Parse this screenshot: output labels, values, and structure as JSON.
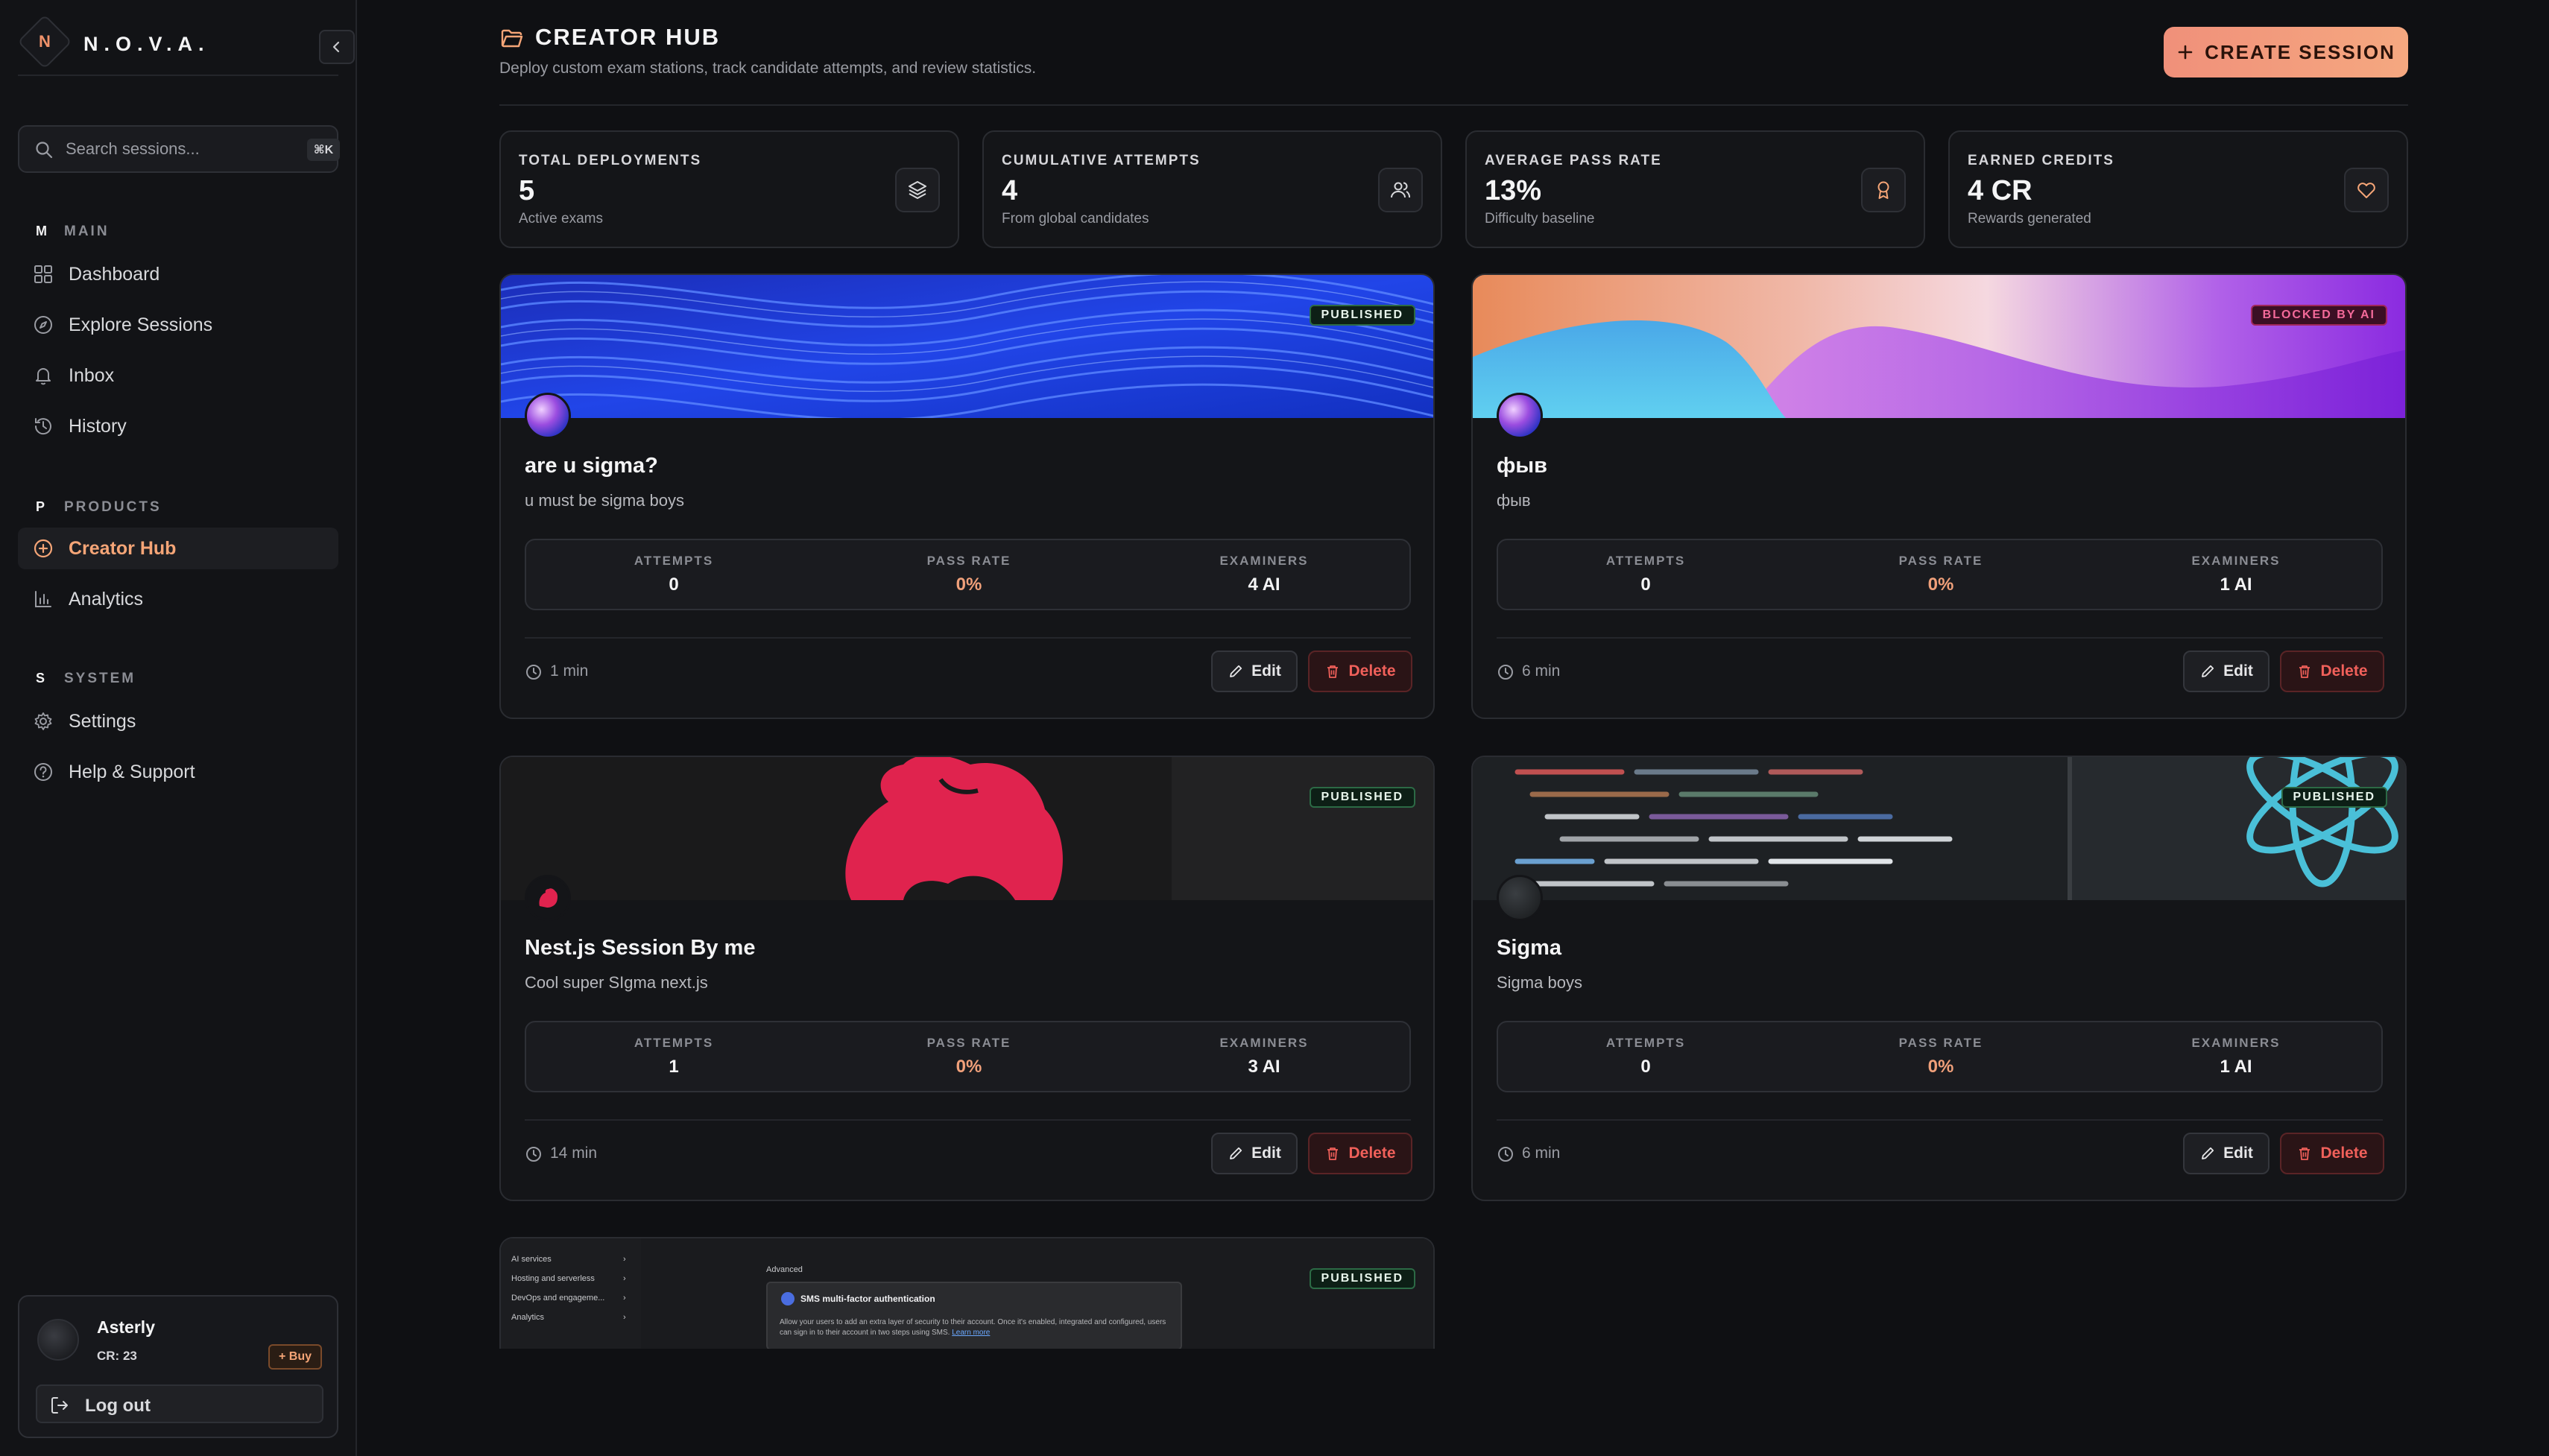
{
  "brand": {
    "name": "N.O.V.A.",
    "logo_letter": "N"
  },
  "search": {
    "placeholder": "Search sessions...",
    "shortcut": "⌘K"
  },
  "nav": {
    "main": {
      "letter": "M",
      "label": "MAIN",
      "items": [
        {
          "label": "Dashboard",
          "icon": "grid-icon"
        },
        {
          "label": "Explore Sessions",
          "icon": "compass-icon"
        },
        {
          "label": "Inbox",
          "icon": "bell-icon"
        },
        {
          "label": "History",
          "icon": "history-icon"
        }
      ]
    },
    "products": {
      "letter": "P",
      "label": "PRODUCTS",
      "items": [
        {
          "label": "Creator Hub",
          "icon": "plus-circle-icon",
          "active": true
        },
        {
          "label": "Analytics",
          "icon": "bar-chart-icon"
        }
      ]
    },
    "system": {
      "letter": "S",
      "label": "SYSTEM",
      "items": [
        {
          "label": "Settings",
          "icon": "gear-icon"
        },
        {
          "label": "Help & Support",
          "icon": "help-icon"
        }
      ]
    }
  },
  "user": {
    "name": "Asterly",
    "credits": "CR: 23",
    "buy_label": "+ Buy",
    "logout_label": "Log out"
  },
  "header": {
    "title": "CREATOR HUB",
    "subtitle": "Deploy custom exam stations, track candidate attempts, and review statistics.",
    "create_label": "CREATE SESSION"
  },
  "stats": [
    {
      "label": "TOTAL DEPLOYMENTS",
      "value": "5",
      "sub": "Active exams",
      "icon": "layers-icon"
    },
    {
      "label": "CUMULATIVE ATTEMPTS",
      "value": "4",
      "sub": "From global candidates",
      "icon": "users-icon"
    },
    {
      "label": "AVERAGE PASS RATE",
      "value": "13%",
      "sub": "Difficulty baseline",
      "icon": "award-icon"
    },
    {
      "label": "EARNED CREDITS",
      "value": "4 CR",
      "sub": "Rewards generated",
      "icon": "heart-icon"
    }
  ],
  "stat_labels": {
    "attempts": "ATTEMPTS",
    "pass_rate": "PASS RATE",
    "examiners": "EXAMINERS"
  },
  "actions": {
    "edit": "Edit",
    "delete": "Delete"
  },
  "sessions": [
    {
      "title": "are u sigma?",
      "description": "u must be sigma boys",
      "status": "PUBLISHED",
      "attempts": "0",
      "pass_rate": "0%",
      "examiners": "4 AI",
      "duration": "1 min"
    },
    {
      "title": "фыв",
      "description": "фыв",
      "status": "BLOCKED BY AI",
      "attempts": "0",
      "pass_rate": "0%",
      "examiners": "1 AI",
      "duration": "6 min"
    },
    {
      "title": "Nest.js Session By me",
      "description": "Cool super SIgma next.js",
      "status": "PUBLISHED",
      "attempts": "1",
      "pass_rate": "0%",
      "examiners": "3 AI",
      "duration": "14 min"
    },
    {
      "title": "Sigma",
      "description": "Sigma boys",
      "status": "PUBLISHED",
      "attempts": "0",
      "pass_rate": "0%",
      "examiners": "1 AI",
      "duration": "6 min"
    },
    {
      "title": "",
      "description": "",
      "status": "PUBLISHED",
      "thumb": {
        "menu": [
          "AI services",
          "Hosting and serverless",
          "DevOps and engageme...",
          "Analytics"
        ],
        "section": "Advanced",
        "panel_title": "SMS multi-factor authentication",
        "panel_desc": "Allow your users to add an extra layer of security to their account. Once it's enabled, integrated and configured, users can sign in to their account in two steps using SMS.",
        "panel_link": "Learn more"
      }
    }
  ],
  "colors": {
    "accent": "#f5a577",
    "published": "#2c6a45",
    "blocked": "#f46a9a",
    "danger": "#f0605a"
  }
}
